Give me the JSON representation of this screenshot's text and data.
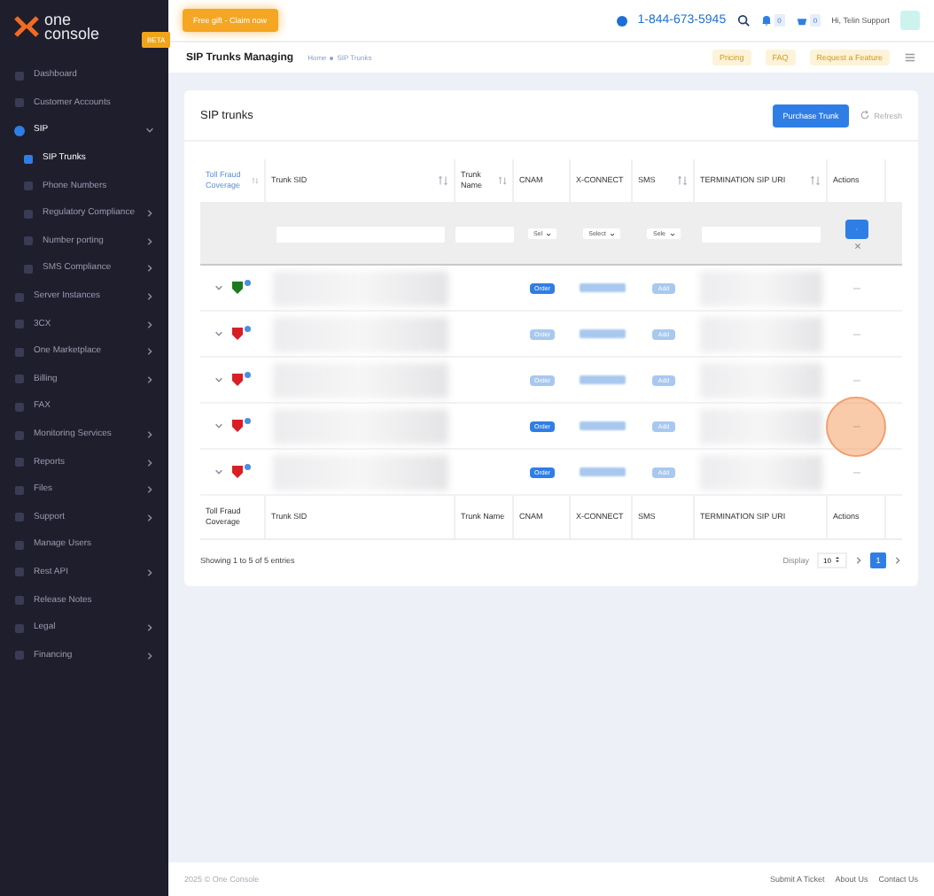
{
  "brand": {
    "name_top": "one",
    "name_bottom": "console",
    "badge": "BETA"
  },
  "topbar": {
    "promo": "Free gift - Claim now",
    "phone": "1-844-673-5945",
    "notifications": "0",
    "cart": "0",
    "user": "Hi, Telin Support"
  },
  "sidebar": {
    "items": [
      {
        "label": "Dashboard",
        "submenu": false,
        "selected": false
      },
      {
        "label": "Customer Accounts",
        "submenu": false,
        "selected": false
      },
      {
        "label": "SIP",
        "submenu": true,
        "expanded": true,
        "selected": true,
        "children": [
          {
            "label": "SIP Trunks",
            "submenu": false,
            "selected": true
          },
          {
            "label": "Phone Numbers",
            "submenu": false,
            "selected": false
          },
          {
            "label": "Regulatory Compliance",
            "submenu": true,
            "selected": false
          },
          {
            "label": "Number porting",
            "submenu": true,
            "selected": false
          },
          {
            "label": "SMS Compliance",
            "submenu": true,
            "selected": false
          }
        ]
      },
      {
        "label": "Server Instances",
        "submenu": true,
        "selected": false
      },
      {
        "label": "3CX",
        "submenu": true,
        "selected": false
      },
      {
        "label": "One Marketplace",
        "submenu": true,
        "selected": false
      },
      {
        "label": "Billing",
        "submenu": true,
        "selected": false
      },
      {
        "label": "FAX",
        "submenu": false,
        "selected": false
      },
      {
        "label": "Monitoring Services",
        "submenu": true,
        "selected": false
      },
      {
        "label": "Reports",
        "submenu": true,
        "selected": false
      },
      {
        "label": "Files",
        "submenu": true,
        "selected": false
      },
      {
        "label": "Support",
        "submenu": true,
        "selected": false
      },
      {
        "label": "Manage Users",
        "submenu": false,
        "selected": false
      },
      {
        "label": "Rest API",
        "submenu": true,
        "selected": false
      },
      {
        "label": "Release Notes",
        "submenu": false,
        "selected": false
      },
      {
        "label": "Legal",
        "submenu": true,
        "selected": false
      },
      {
        "label": "Financing",
        "submenu": true,
        "selected": false
      }
    ]
  },
  "subheader": {
    "title": "SIP Trunks Managing",
    "breadcrumb": [
      "Home",
      "SIP Trunks"
    ],
    "buttons": [
      "Pricing",
      "FAQ",
      "Request a Feature"
    ]
  },
  "card": {
    "title": "SIP trunks",
    "primary_button": "Purchase Trunk",
    "refresh_button": "Refresh"
  },
  "table": {
    "columns": [
      {
        "label": "Toll Fraud Coverage",
        "sortable": true,
        "sorted": true,
        "kind": "none"
      },
      {
        "label": "Trunk SID",
        "sortable": true,
        "sorted": false,
        "kind": "input"
      },
      {
        "label": "Trunk Name",
        "sortable": true,
        "sorted": false,
        "kind": "input"
      },
      {
        "label": "CNAM",
        "sortable": false,
        "sorted": false,
        "kind": "select",
        "filter_value": "Sel"
      },
      {
        "label": "X-CONNECT",
        "sortable": false,
        "sorted": false,
        "kind": "select",
        "filter_value": "Select"
      },
      {
        "label": "SMS",
        "sortable": true,
        "sorted": false,
        "kind": "select",
        "filter_value": "Sele"
      },
      {
        "label": "TERMINATION SIP URI",
        "sortable": true,
        "sorted": false,
        "kind": "input"
      },
      {
        "label": "Actions",
        "sortable": false,
        "sorted": false,
        "kind": "actions"
      }
    ],
    "rows": [
      {
        "color": "#1e7a1e",
        "cnam": "Order",
        "cnam_enabled": true,
        "sms": "Add",
        "action": "—"
      },
      {
        "color": "#d81f26",
        "cnam": "Order",
        "cnam_enabled": false,
        "sms": "Add",
        "action": "—"
      },
      {
        "color": "#d81f26",
        "cnam": "Order",
        "cnam_enabled": false,
        "sms": "Add",
        "action": "—"
      },
      {
        "color": "#d81f26",
        "cnam": "Order",
        "cnam_enabled": true,
        "sms": "Add",
        "action": "—"
      },
      {
        "color": "#d81f26",
        "cnam": "Order",
        "cnam_enabled": true,
        "sms": "Add",
        "action": "—"
      }
    ],
    "footer_columns": [
      "Toll Fraud Coverage",
      "Trunk SID",
      "Trunk Name",
      "CNAM",
      "X-CONNECT",
      "SMS",
      "TERMINATION SIP URI",
      "Actions"
    ],
    "info": "Showing 1 to 5 of 5 entries",
    "display_label": "Display",
    "page_size": "10",
    "pages": [
      {
        "label": "1",
        "selected": true
      }
    ]
  },
  "footer": {
    "copyright": "2025 © One Console",
    "links": [
      "Submit A Ticket",
      "About Us",
      "Contact Us"
    ]
  }
}
